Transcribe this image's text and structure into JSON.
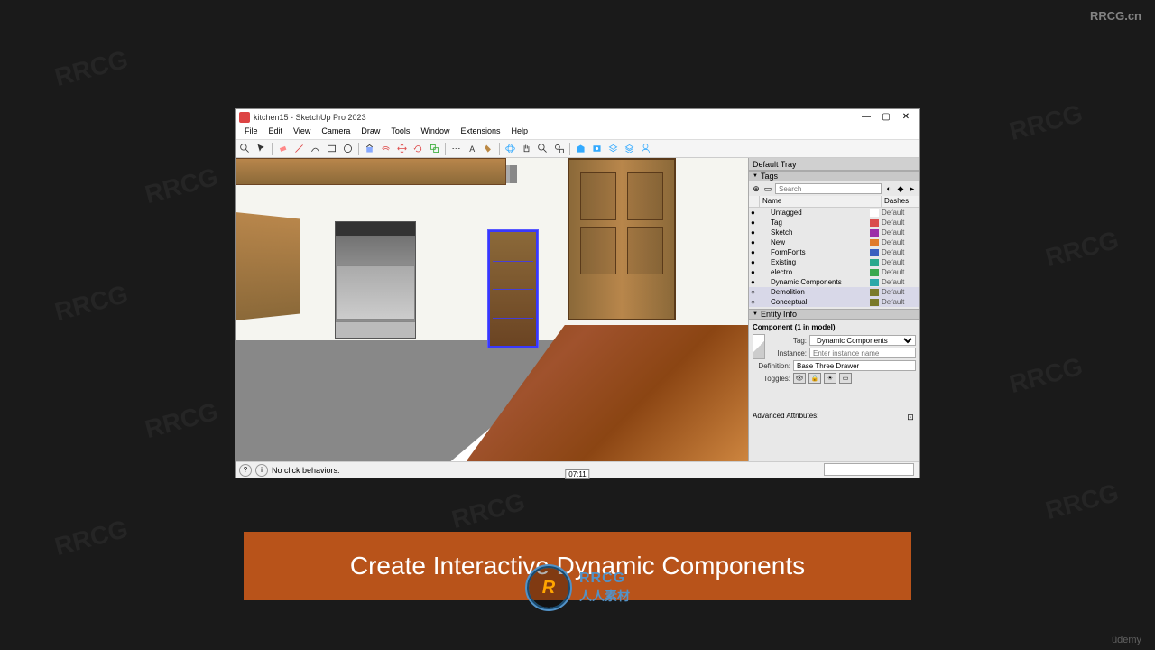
{
  "watermark": {
    "top_right": "RRCG.cn",
    "bottom_right": "ûdemy",
    "diagonal": "RRCG"
  },
  "app": {
    "title": "kitchen15 - SketchUp Pro 2023",
    "menus": [
      "File",
      "Edit",
      "View",
      "Camera",
      "Draw",
      "Tools",
      "Window",
      "Extensions",
      "Help"
    ]
  },
  "status": {
    "message": "No click behaviors.",
    "time_badge": "07:11"
  },
  "tray": {
    "title": "Default Tray",
    "tags_panel": {
      "title": "Tags",
      "search_placeholder": "Search",
      "columns": {
        "name": "Name",
        "dashes": "Dashes"
      },
      "rows": [
        {
          "name": "Untagged",
          "color": "#ffffff",
          "dash": "Default"
        },
        {
          "name": "Tag",
          "color": "#d94d4d",
          "dash": "Default"
        },
        {
          "name": "Sketch",
          "color": "#9b2ea8",
          "dash": "Default"
        },
        {
          "name": "New",
          "color": "#e07a2a",
          "dash": "Default"
        },
        {
          "name": "FormFonts",
          "color": "#3a5fbf",
          "dash": "Default"
        },
        {
          "name": "Existing",
          "color": "#2aa88c",
          "dash": "Default"
        },
        {
          "name": "electro",
          "color": "#3aa84d",
          "dash": "Default"
        },
        {
          "name": "Dynamic Components",
          "color": "#2aa8a8",
          "dash": "Default"
        },
        {
          "name": "Demolition",
          "color": "#7a7a2a",
          "dash": "Default"
        },
        {
          "name": "Conceptual",
          "color": "#7a7a2a",
          "dash": "Default"
        }
      ]
    },
    "entity_panel": {
      "title": "Entity Info",
      "component_title": "Component (1 in model)",
      "tag_label": "Tag:",
      "tag_value": "Dynamic Components",
      "instance_label": "Instance:",
      "instance_placeholder": "Enter instance name",
      "definition_label": "Definition:",
      "definition_value": "Base Three Drawer",
      "toggles_label": "Toggles:",
      "advanced_label": "Advanced Attributes:"
    }
  },
  "caption": "Create Interactive Dynamic Components",
  "logo": {
    "inner": "R",
    "en": "RRCG",
    "cn": "人人素材"
  }
}
